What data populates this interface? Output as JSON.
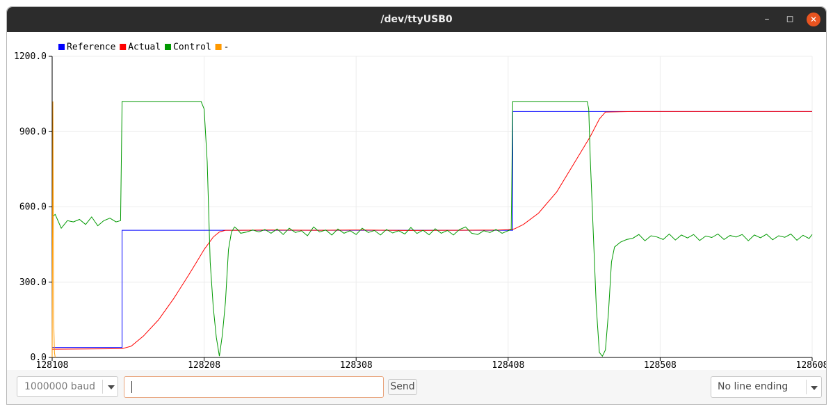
{
  "window": {
    "title": "/dev/ttyUSB0"
  },
  "footer": {
    "baud": "1000000 baud",
    "message": "",
    "send_label": "Send",
    "line_ending": "No line ending"
  },
  "chart_data": {
    "type": "line",
    "ylim": [
      0,
      1200
    ],
    "yticks": [
      0,
      300,
      600,
      900,
      1200
    ],
    "ytick_labels": [
      "0.0",
      "300.0",
      "600.0",
      "900.0",
      "1200.0"
    ],
    "xlim": [
      128108,
      128608
    ],
    "xticks": [
      128108,
      128208,
      128308,
      128408,
      128508,
      128608
    ],
    "xtick_labels": [
      "128108",
      "128208",
      "128308",
      "128408",
      "128508",
      "128608"
    ],
    "grid": true,
    "legend_position": "top-left",
    "series": [
      {
        "name": "Reference",
        "color": "#0000ff",
        "x": [
          128108,
          128154,
          128154,
          128411,
          128411,
          128608
        ],
        "y": [
          40,
          40,
          507,
          507,
          980,
          980
        ]
      },
      {
        "name": "Actual",
        "color": "#ff0000",
        "x": [
          128108,
          128154,
          128160,
          128168,
          128178,
          128188,
          128198,
          128204,
          128208,
          128214,
          128218,
          128222,
          128232,
          128252,
          128282,
          128312,
          128342,
          128372,
          128402,
          128408,
          128412,
          128418,
          128428,
          128440,
          128452,
          128462,
          128468,
          128472,
          128490,
          128520,
          128550,
          128580,
          128608
        ],
        "y": [
          33,
          35,
          45,
          85,
          150,
          235,
          330,
          390,
          430,
          480,
          500,
          507,
          507,
          508,
          507,
          508,
          506,
          507,
          508,
          509,
          512,
          530,
          575,
          660,
          780,
          880,
          950,
          978,
          980,
          980,
          980,
          980,
          980
        ]
      },
      {
        "name": "Control",
        "color": "#009900",
        "x": [
          128108,
          128110,
          128114,
          128118,
          128122,
          128126,
          128130,
          128134,
          128138,
          128142,
          128146,
          128150,
          128153,
          128154,
          128206,
          128208,
          128210,
          128212,
          128214,
          128216,
          128218,
          128220,
          128222,
          128224,
          128226,
          128228,
          128230,
          128232,
          128236,
          128240,
          128244,
          128248,
          128252,
          128256,
          128260,
          128264,
          128268,
          128272,
          128276,
          128280,
          128284,
          128288,
          128292,
          128296,
          128300,
          128304,
          128308,
          128312,
          128316,
          128320,
          128324,
          128328,
          128332,
          128336,
          128340,
          128344,
          128348,
          128352,
          128356,
          128360,
          128364,
          128368,
          128372,
          128376,
          128380,
          128384,
          128388,
          128392,
          128396,
          128400,
          128404,
          128408,
          128410,
          128411,
          128460,
          128461,
          128462,
          128464,
          128466,
          128468,
          128470,
          128472,
          128474,
          128476,
          128478,
          128480,
          128482,
          128486,
          128490,
          128494,
          128498,
          128502,
          128506,
          128510,
          128514,
          128518,
          128522,
          128526,
          128530,
          128534,
          128538,
          128542,
          128546,
          128550,
          128554,
          128558,
          128562,
          128566,
          128570,
          128574,
          128578,
          128582,
          128586,
          128590,
          128594,
          128598,
          128602,
          128606,
          128608
        ],
        "y": [
          560,
          570,
          515,
          545,
          540,
          550,
          530,
          560,
          525,
          545,
          555,
          540,
          545,
          1020,
          1020,
          990,
          780,
          380,
          200,
          80,
          5,
          90,
          220,
          430,
          500,
          520,
          510,
          495,
          500,
          508,
          500,
          510,
          495,
          512,
          490,
          515,
          498,
          505,
          485,
          520,
          500,
          508,
          488,
          512,
          495,
          505,
          490,
          515,
          498,
          506,
          488,
          510,
          496,
          505,
          492,
          518,
          494,
          507,
          489,
          513,
          495,
          506,
          488,
          510,
          520,
          495,
          490,
          505,
          498,
          510,
          495,
          505,
          510,
          1020,
          1020,
          990,
          800,
          500,
          200,
          20,
          5,
          30,
          180,
          380,
          440,
          450,
          460,
          470,
          475,
          490,
          465,
          485,
          480,
          470,
          492,
          468,
          488,
          476,
          490,
          466,
          484,
          478,
          492,
          470,
          486,
          480,
          490,
          465,
          488,
          477,
          491,
          469,
          485,
          479,
          492,
          467,
          487,
          474,
          490
        ]
      },
      {
        "name": "-",
        "color": "#ff9900",
        "x": [
          128108,
          128108.5,
          128109,
          128109.5,
          128110
        ],
        "y": [
          0,
          1020,
          150,
          20,
          0
        ]
      }
    ]
  }
}
